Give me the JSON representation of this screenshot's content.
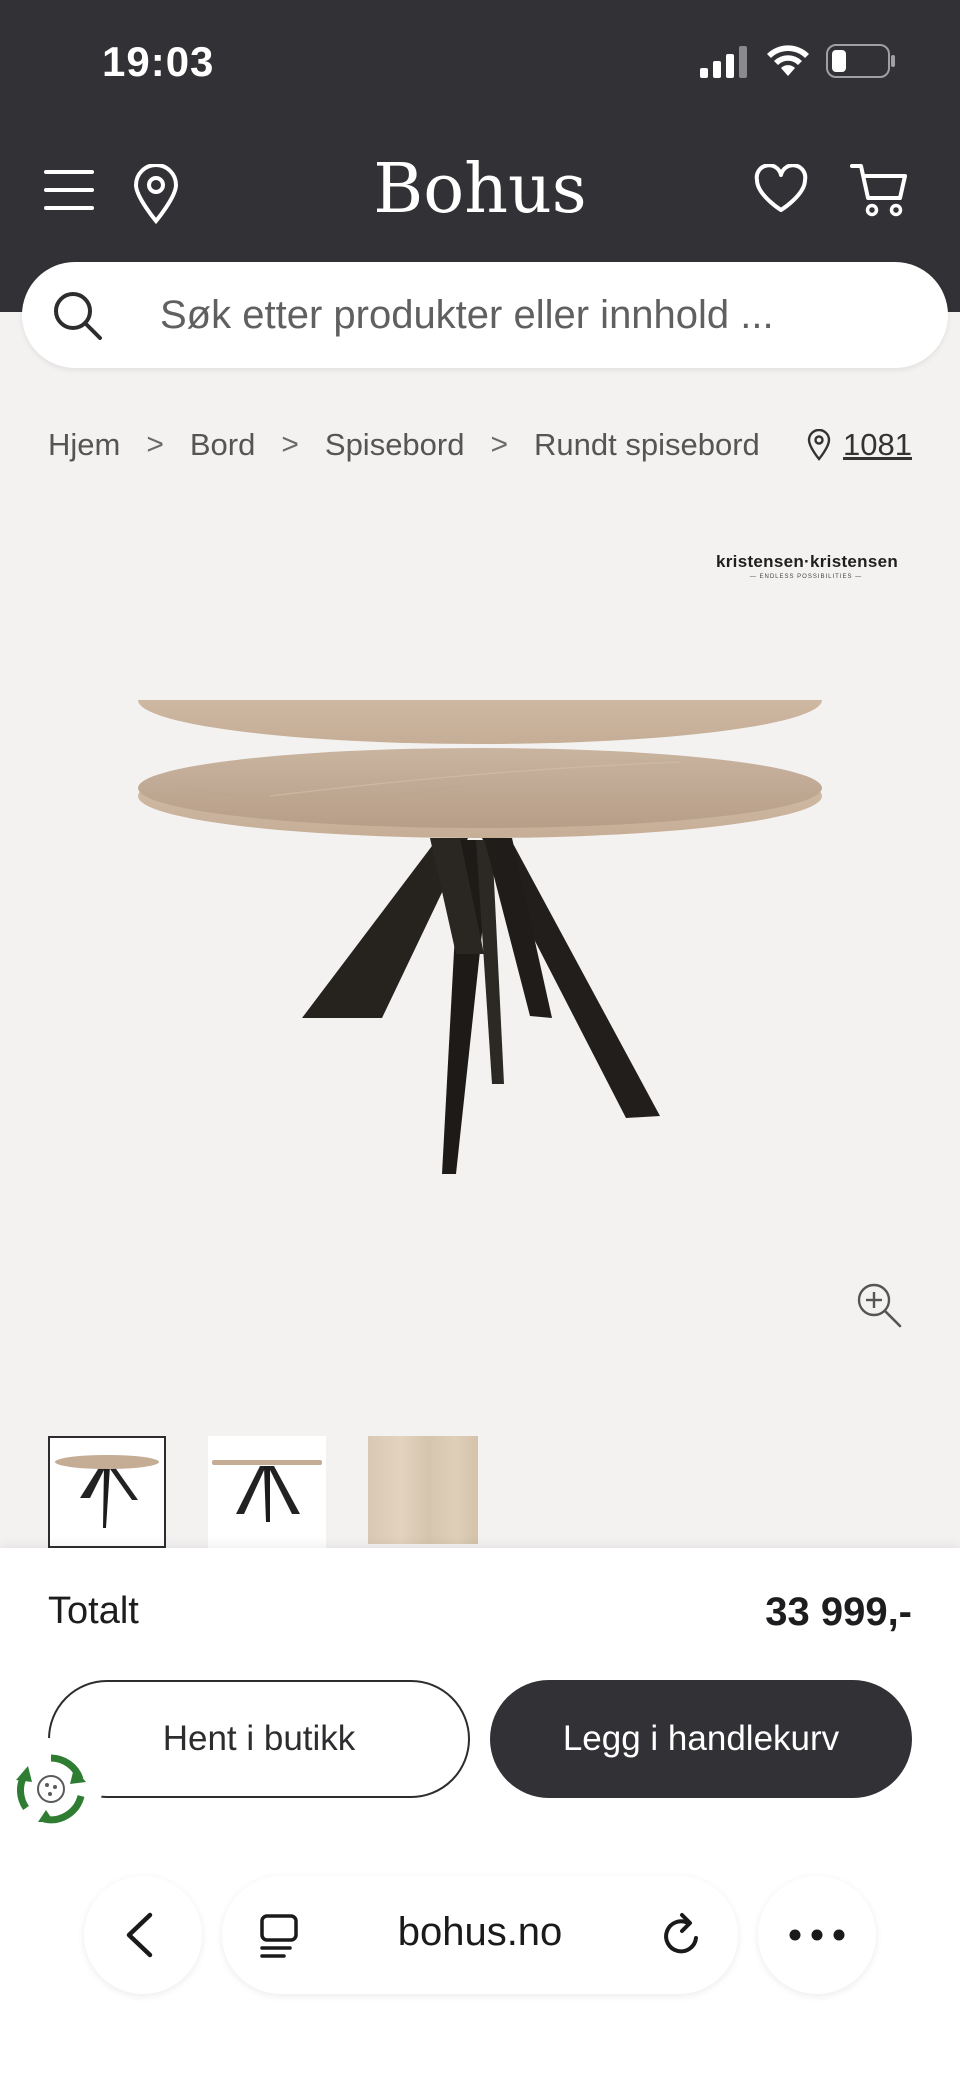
{
  "status_bar": {
    "time": "19:03"
  },
  "header": {
    "logo": "Bohus"
  },
  "search": {
    "placeholder": "Søk etter produkter eller innhold ..."
  },
  "breadcrumb": {
    "items": [
      "Hjem",
      "Bord",
      "Spisebord",
      "Rundt spisebord"
    ],
    "separator": ">"
  },
  "store": {
    "label": "1081"
  },
  "brand": {
    "name": "kristensen·kristensen",
    "tagline": "— ENDLESS POSSIBILITIES —"
  },
  "product": {
    "image": "round-dining-table-icon"
  },
  "summary": {
    "total_label": "Totalt",
    "total_price": "33 999,-"
  },
  "actions": {
    "pickup": "Hent i butikk",
    "add_to_cart": "Legg i handlekurv"
  },
  "browser": {
    "url": "bohus.no"
  },
  "colors": {
    "header_bg": "#323236",
    "page_bg": "#f4f2f1",
    "button_dark": "#323236"
  }
}
